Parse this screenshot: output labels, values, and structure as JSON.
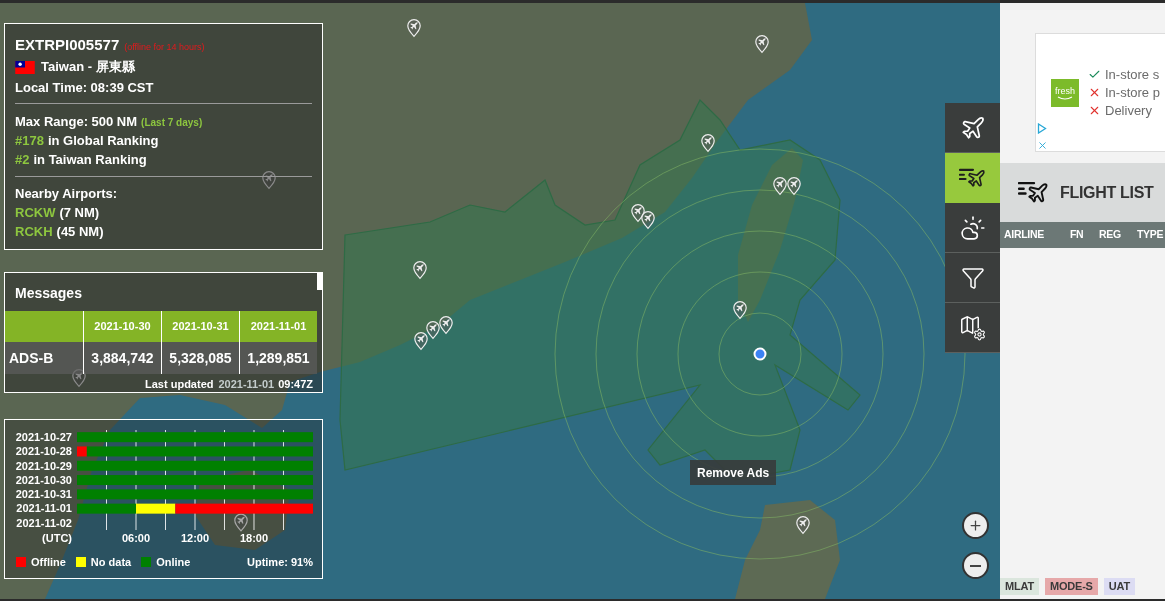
{
  "station": {
    "id": "EXTRPI005577",
    "status_note": "(offline for 14 hours)",
    "location": "Taiwan - 屏東縣",
    "local_time": "Local Time: 08:39 CST",
    "max_range": "Max Range: 500 NM",
    "range_period": "(Last 7 days)",
    "rankings": [
      {
        "rank": "#178",
        "label": "in Global Ranking"
      },
      {
        "rank": "#2",
        "label": "in Taiwan Ranking"
      }
    ],
    "airports_title": "Nearby Airports:",
    "airports": [
      {
        "code": "RCKW",
        "distance": "(7 NM)"
      },
      {
        "code": "RCKH",
        "distance": "(45 NM)"
      }
    ]
  },
  "messages": {
    "title": "Messages",
    "columns": [
      "2021-10-30",
      "2021-10-31",
      "2021-11-01"
    ],
    "rows": [
      {
        "label": "ADS-B",
        "values": [
          "3,884,742",
          "5,328,085",
          "1,289,851"
        ]
      }
    ],
    "updated_label": "Last updated",
    "updated_date": "2021-11-01",
    "updated_time": "09:47Z"
  },
  "uptime": {
    "chart_data": {
      "type": "bar",
      "orientation": "horizontal",
      "stacked": true,
      "grid": true,
      "xlabel": "(UTC)",
      "categories": [
        "2021-10-27",
        "2021-10-28",
        "2021-10-29",
        "2021-10-30",
        "2021-10-31",
        "2021-11-01",
        "2021-11-02"
      ],
      "series": [
        {
          "color": "#ff0000",
          "values": [
            0,
            1,
            0,
            0,
            0,
            0,
            null
          ]
        },
        {
          "color": "#008000",
          "values": [
            24,
            23,
            24,
            24,
            24,
            6,
            null
          ]
        },
        {
          "color": "#ffff00",
          "values": [
            0,
            0,
            0,
            0,
            0,
            4,
            null
          ]
        },
        {
          "color": "#ff0000",
          "values": [
            0,
            0,
            0,
            0,
            0,
            14,
            null
          ]
        }
      ],
      "xlim": [
        0,
        24
      ],
      "xticks": [
        {
          "value": 6,
          "label": "06:00"
        },
        {
          "value": 12,
          "label": "12:00"
        },
        {
          "value": 18,
          "label": "18:00"
        }
      ]
    },
    "legend": [
      {
        "label": "Offline",
        "color": "#ff0000"
      },
      {
        "label": "No data",
        "color": "#ffff00"
      },
      {
        "label": "Online",
        "color": "#008000"
      }
    ],
    "uptime": "Uptime: 91%"
  },
  "map": {
    "remove_ads": "Remove Ads"
  },
  "toolbar": [
    {
      "selected": false
    },
    {
      "selected": true
    },
    {
      "selected": false
    },
    {
      "selected": false
    },
    {
      "selected": false
    }
  ],
  "ad": {
    "logo": "fresh",
    "lines": [
      {
        "kind": "check",
        "text": "In-store s"
      },
      {
        "kind": "cross",
        "text": "In-store p"
      },
      {
        "kind": "cross",
        "text": "Delivery"
      }
    ]
  },
  "flight_list": {
    "title": "FLIGHT LIST",
    "columns": [
      "AIRLINE",
      "FN",
      "REG",
      "TYPE"
    ]
  },
  "badges": [
    {
      "label": "MLAT",
      "color": "#dbe6dd"
    },
    {
      "label": "MODE-S",
      "color": "#e6a8a9"
    },
    {
      "label": "UAT",
      "color": "#dcdcf3"
    }
  ]
}
